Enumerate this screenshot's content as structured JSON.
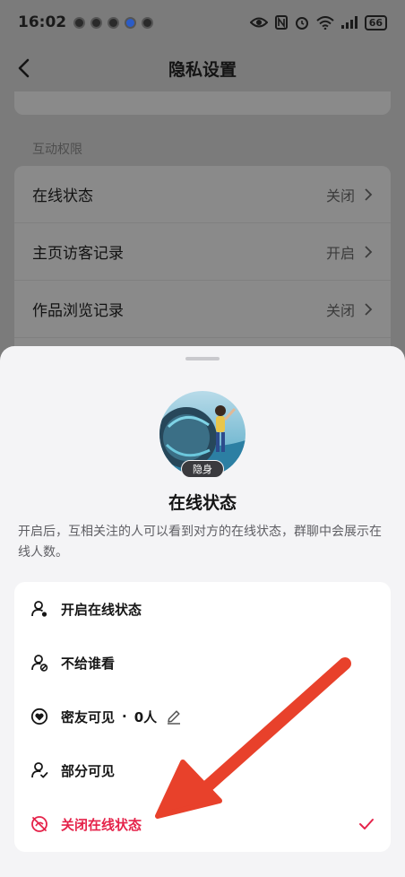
{
  "status_bar": {
    "time": "16:02",
    "battery": "66"
  },
  "header": {
    "title": "隐私设置"
  },
  "interaction_section": {
    "label": "互动权限",
    "rows": [
      {
        "label": "在线状态",
        "value": "关闭"
      },
      {
        "label": "主页访客记录",
        "value": "开启"
      },
      {
        "label": "作品浏览记录",
        "value": "关闭"
      }
    ]
  },
  "sheet": {
    "badge": "隐身",
    "title": "在线状态",
    "description": "开启后，互相关注的人可以看到对方的在线状态，群聊中会展示在线人数。",
    "options": [
      {
        "label": "开启在线状态",
        "icon": "person-online-icon"
      },
      {
        "label": "不给谁看",
        "icon": "person-blocked-icon"
      },
      {
        "label": "密友可见",
        "separator": "·",
        "count": "0人",
        "icon": "heart-circle-icon"
      },
      {
        "label": "部分可见",
        "icon": "person-check-icon"
      },
      {
        "label": "关闭在线状态",
        "icon": "offline-icon",
        "selected": true
      }
    ]
  },
  "colors": {
    "accent": "#e5234a",
    "arrow": "#e8412b"
  }
}
